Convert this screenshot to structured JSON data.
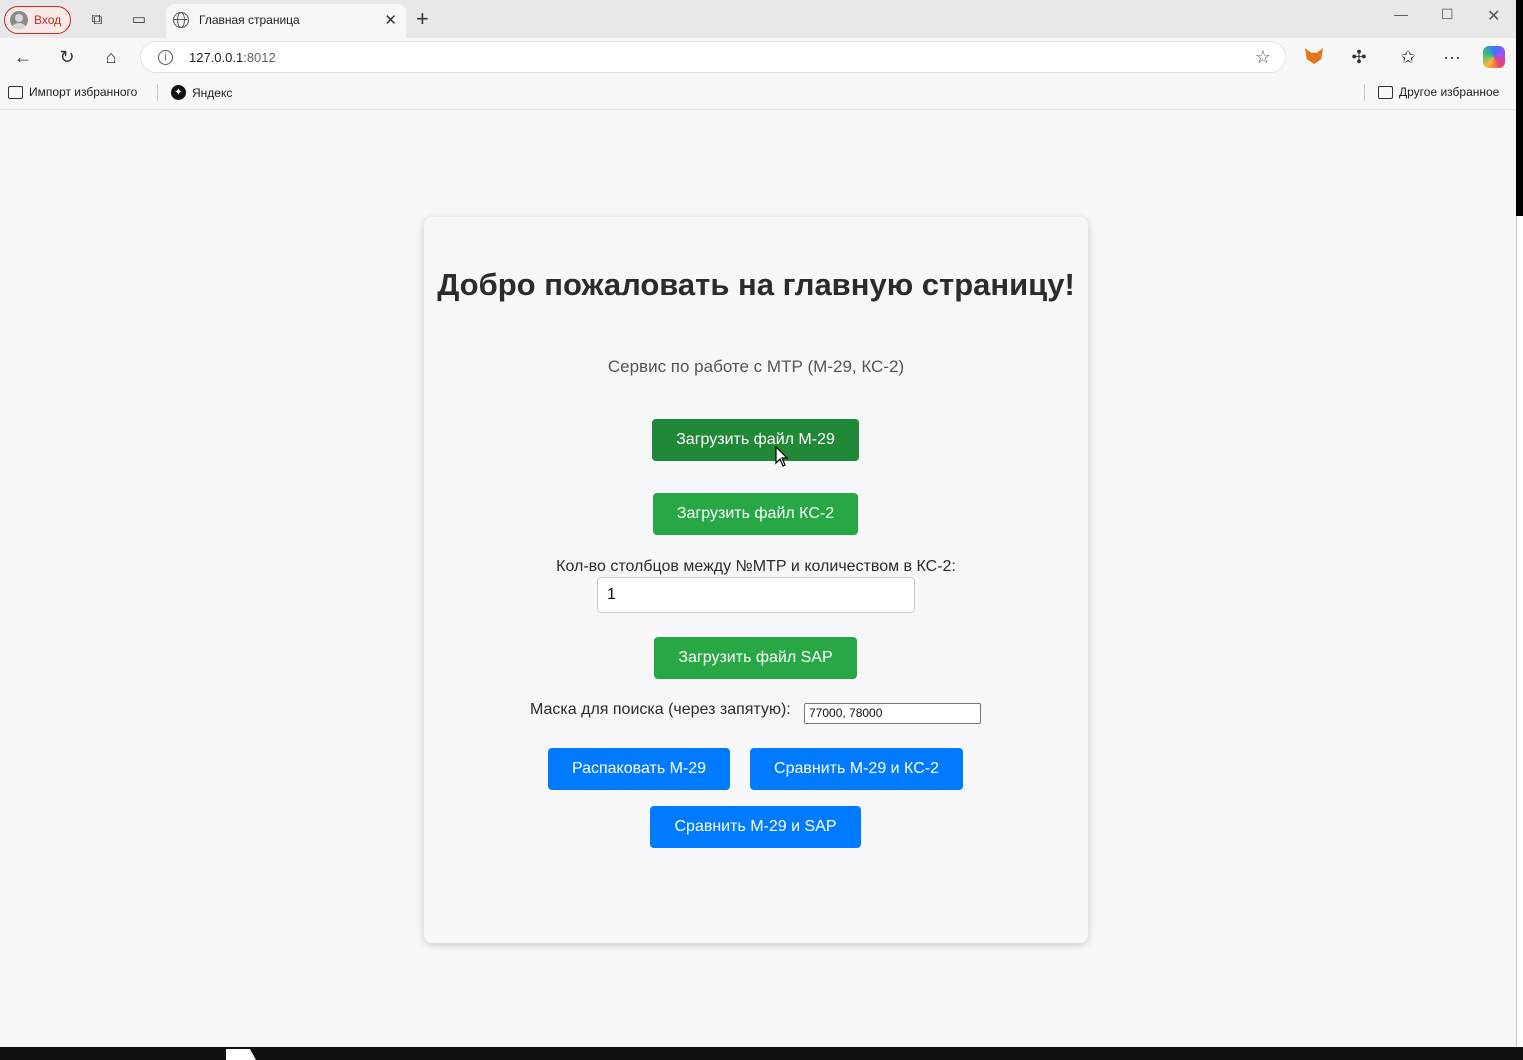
{
  "browser": {
    "profile_label": "Вход",
    "tab_title": "Главная страница",
    "url_host": "127.0.0.1",
    "url_port": ":8012",
    "bookmarks": [
      "Импорт избранного",
      "Яндекс"
    ],
    "other_bookmarks": "Другое избранное"
  },
  "main": {
    "heading": "Добро пожаловать на главную страницу!",
    "subtitle": "Сервис по работе с МТР (М-29, КС-2)",
    "upload_m29": "Загрузить файл М-29",
    "upload_ks2": "Загрузить файл КС-2",
    "columns_label": "Кол-во столбцов между №МТР и количеством в КС-2:",
    "columns_value": "1",
    "upload_sap": "Загрузить файл SAP",
    "mask_label": "Маска для поиска (через запятую):",
    "mask_value": "77000, 78000",
    "unpack_m29": "Распаковать М-29",
    "compare_m29_ks2": "Сравнить М-29 и КС-2",
    "compare_m29_sap": "Сравнить М-29 и SAP"
  },
  "colors": {
    "green": "#28a745",
    "green_hover": "#218838",
    "blue": "#007bff"
  }
}
